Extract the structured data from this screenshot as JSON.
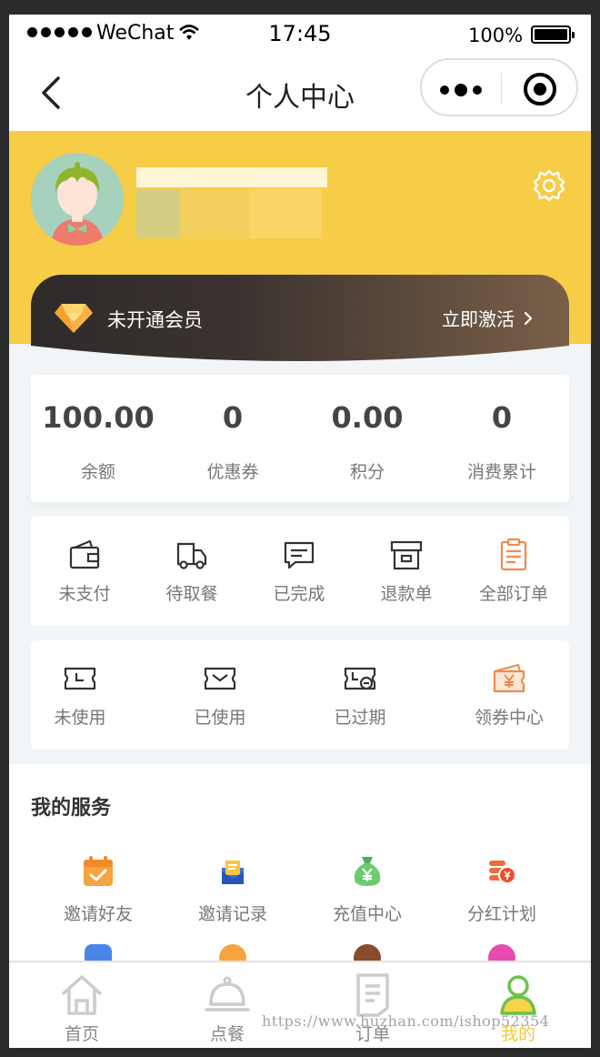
{
  "status_bar": {
    "carrier": "WeChat",
    "time": "17:45",
    "battery": "100%"
  },
  "nav": {
    "title": "个人中心",
    "back_icon": "chevron-left-icon",
    "more_icon": "more-dots-icon",
    "close_icon": "target-icon"
  },
  "profile": {
    "avatar_icon": "avatar-girl",
    "settings_icon": "gear-icon"
  },
  "vip": {
    "label": "未开通会员",
    "activate_label": "立即激活",
    "icon": "diamond-icon"
  },
  "stats": [
    {
      "value": "100.00",
      "label": "余额"
    },
    {
      "value": "0",
      "label": "优惠券"
    },
    {
      "value": "0.00",
      "label": "积分"
    },
    {
      "value": "0",
      "label": "消费累计"
    }
  ],
  "orders": [
    {
      "label": "未支付",
      "icon": "wallet-icon"
    },
    {
      "label": "待取餐",
      "icon": "truck-icon"
    },
    {
      "label": "已完成",
      "icon": "message-icon"
    },
    {
      "label": "退款单",
      "icon": "archive-icon"
    },
    {
      "label": "全部订单",
      "icon": "clipboard-icon"
    }
  ],
  "coupons": [
    {
      "label": "未使用",
      "icon": "ticket-clock-icon"
    },
    {
      "label": "已使用",
      "icon": "ticket-check-icon"
    },
    {
      "label": "已过期",
      "icon": "ticket-expired-icon"
    },
    {
      "label": "领券中心",
      "icon": "coupon-yen-icon"
    }
  ],
  "services": {
    "title": "我的服务",
    "items": [
      {
        "label": "邀请好友",
        "icon": "calendar-check-icon"
      },
      {
        "label": "邀请记录",
        "icon": "mail-record-icon"
      },
      {
        "label": "充值中心",
        "icon": "money-bag-icon"
      },
      {
        "label": "分红计划",
        "icon": "coins-icon"
      }
    ]
  },
  "tabbar": [
    {
      "label": "首页",
      "icon": "home-icon",
      "active": false
    },
    {
      "label": "点餐",
      "icon": "dish-cover-icon",
      "active": false
    },
    {
      "label": "订单",
      "icon": "document-icon",
      "active": false
    },
    {
      "label": "我的",
      "icon": "user-icon",
      "active": true
    }
  ],
  "watermark": "https://www.huzhan.com/ishop52354",
  "colors": {
    "accent": "#f7cc47",
    "orange": "#f08a4b",
    "tab_active": "#f7c83a",
    "text_dark": "#444444"
  }
}
